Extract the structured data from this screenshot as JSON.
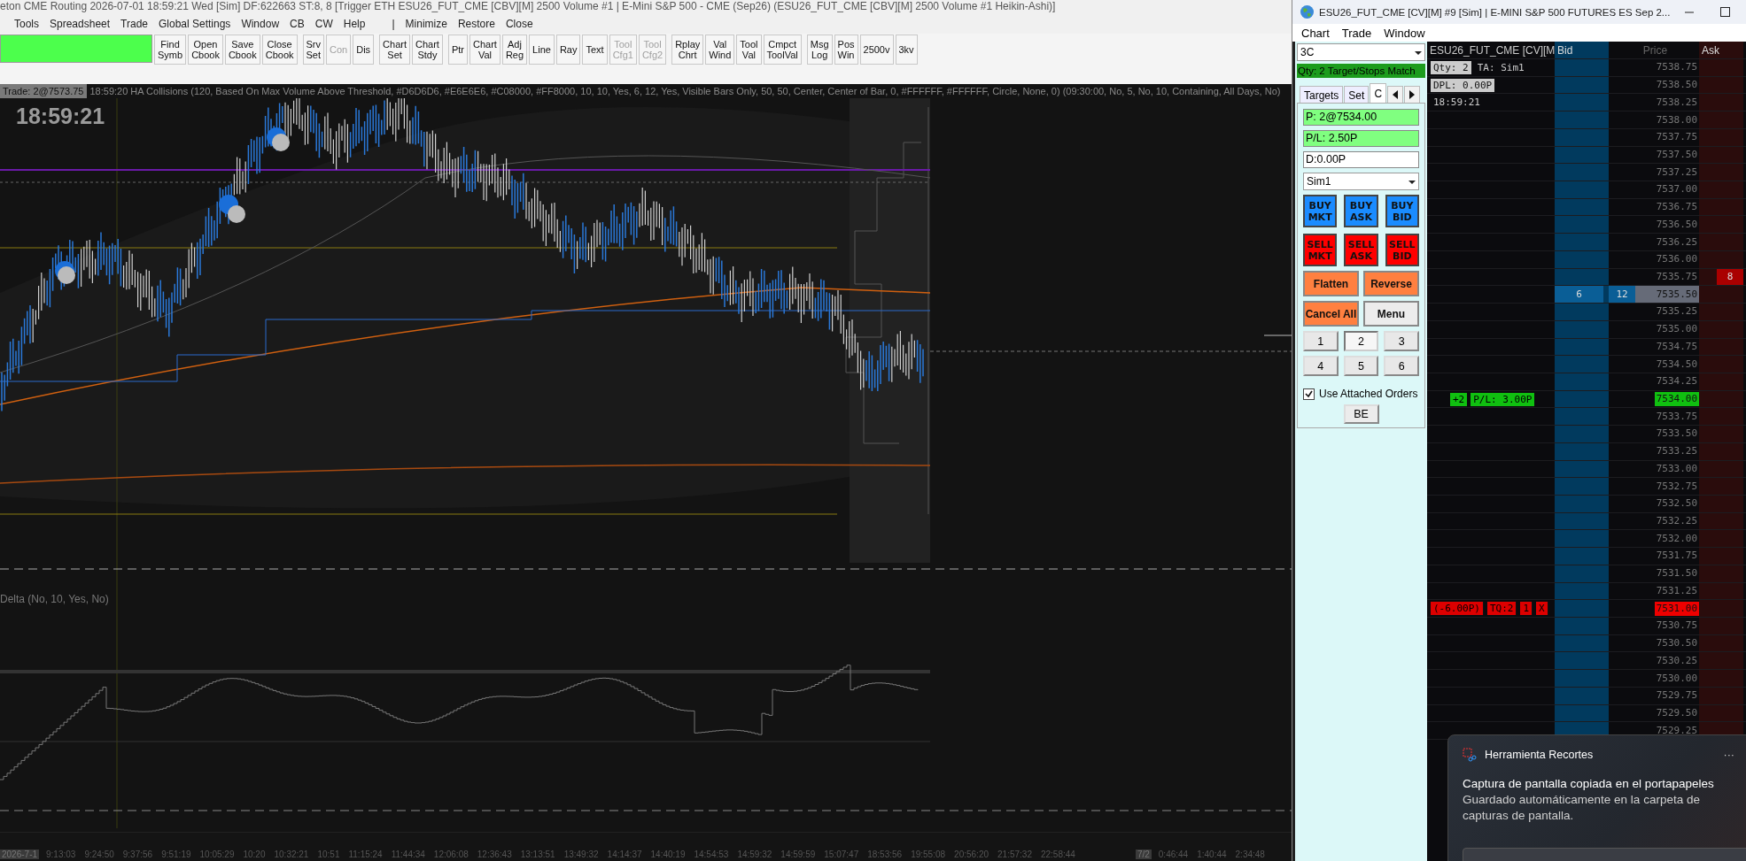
{
  "main_window": {
    "title": "eton CME Routing 2026-07-01  18:59:21 Wed [Sim] DF:622663  ST:8, 8 [Trigger ETH ESU26_FUT_CME [CBV][M]  2500 Volume #1 | E-Mini S&P 500 - CME (Sep26) (ESU26_FUT_CME [CBV][M]  2500 Volume #1 Heikin-Ashi)]",
    "menu": [
      "Tools",
      "Spreadsheet",
      "Trade",
      "Global Settings",
      "Window",
      "CB",
      "CW",
      "Help",
      "|",
      "Minimize",
      "Restore",
      "Close"
    ],
    "toolbar": [
      {
        "label": "Find\nSymb",
        "disabled": false
      },
      {
        "label": "Open\nCbook",
        "disabled": false
      },
      {
        "label": "Save\nCbook",
        "disabled": false
      },
      {
        "label": "Close\nCbook",
        "disabled": false
      },
      {
        "label": "Srv\nSet",
        "disabled": false
      },
      {
        "label": "Con",
        "disabled": true
      },
      {
        "label": "Dis",
        "disabled": false
      },
      {
        "label": "Chart\nSet",
        "disabled": false
      },
      {
        "label": "Chart\nStdy",
        "disabled": false
      },
      {
        "label": "Ptr",
        "disabled": false
      },
      {
        "label": "Chart\nVal",
        "disabled": false
      },
      {
        "label": "Adj\nReg",
        "disabled": false
      },
      {
        "label": "Line",
        "disabled": false
      },
      {
        "label": "Ray",
        "disabled": false
      },
      {
        "label": "Text",
        "disabled": false
      },
      {
        "label": "Tool\nCfg1",
        "disabled": true
      },
      {
        "label": "Tool\nCfg2",
        "disabled": true
      },
      {
        "label": "Rplay\nChrt",
        "disabled": false
      },
      {
        "label": "Val\nWind",
        "disabled": false
      },
      {
        "label": "Tool\nVal",
        "disabled": false
      },
      {
        "label": "Cmpct\nToolVal",
        "disabled": false
      },
      {
        "label": "Msg\nLog",
        "disabled": false
      },
      {
        "label": "Pos\nWin",
        "disabled": false
      },
      {
        "label": "2500v",
        "disabled": false
      },
      {
        "label": "3kv",
        "disabled": false
      }
    ],
    "chart": {
      "trade_label": "Trade: 2@7573.75",
      "study_line": "18:59:20 HA Collisions   (120, Based On Max Volume Above Threshold, #D6D6D6, #E6E6E6, #C08000, #FF8000, 10, 10, Yes, 6, 12, Yes, Visible Bars Only, 50, 50, Center, Center of Bar, 0, #FFFFFF, #FFFFFF, Circle, None, 0)   (09:30:00, No, 5, No, 10, Containing, All Days, No)",
      "clock": "18:59:21",
      "delta_label": "Delta   (No, 10, Yes, No)"
    },
    "time_axis": [
      {
        "label": "2026-7-1",
        "kind": "date"
      },
      {
        "label": "9:13:03",
        "kind": "time"
      },
      {
        "label": "9:24:50",
        "kind": "time"
      },
      {
        "label": "9:37:56",
        "kind": "time"
      },
      {
        "label": "9:51:19",
        "kind": "time"
      },
      {
        "label": "10:05:29",
        "kind": "time"
      },
      {
        "label": "10:20",
        "kind": "time"
      },
      {
        "label": "10:32:21",
        "kind": "time"
      },
      {
        "label": "10:51",
        "kind": "time"
      },
      {
        "label": "11:15:24",
        "kind": "time"
      },
      {
        "label": "11:44:34",
        "kind": "time"
      },
      {
        "label": "12:06:08",
        "kind": "time"
      },
      {
        "label": "12:36:43",
        "kind": "time"
      },
      {
        "label": "13:13:51",
        "kind": "time"
      },
      {
        "label": "13:49:32",
        "kind": "time"
      },
      {
        "label": "14:14:37",
        "kind": "time"
      },
      {
        "label": "14:40:19",
        "kind": "time"
      },
      {
        "label": "14:54:53",
        "kind": "time"
      },
      {
        "label": "14:59:32",
        "kind": "time"
      },
      {
        "label": "14:59:59",
        "kind": "time"
      },
      {
        "label": "15:07:47",
        "kind": "time"
      },
      {
        "label": "18:53:56",
        "kind": "time"
      },
      {
        "label": "19:55:08",
        "kind": "time"
      },
      {
        "label": "20:56:20",
        "kind": "time"
      },
      {
        "label": "21:57:32",
        "kind": "time"
      },
      {
        "label": "22:58:44",
        "kind": "time"
      },
      {
        "label": "7/2",
        "kind": "date"
      },
      {
        "label": "0:46:44",
        "kind": "time"
      },
      {
        "label": "1:40:44",
        "kind": "time"
      },
      {
        "label": "2:34:48",
        "kind": "time"
      }
    ]
  },
  "dom_window": {
    "title": "ESU26_FUT_CME [CV][M] #9 [Sim]  | E-MINI S&P 500 FUTURES ES Sep 2...",
    "menu": [
      "Chart",
      "Trade",
      "Window"
    ],
    "panel": {
      "config": "3C",
      "status": "Qty: 2 Target/Stops Match",
      "tabs": [
        {
          "label": "Targets",
          "selected": false
        },
        {
          "label": "Set",
          "selected": false
        },
        {
          "label": "C",
          "selected": true
        }
      ],
      "fields": [
        {
          "value": "P: 2@7534.00",
          "kind": "good"
        },
        {
          "value": "P/L: 2.50P",
          "kind": "good"
        },
        {
          "value": "D:0.00P",
          "kind": "plain"
        }
      ],
      "account": "Sim1",
      "order_buttons": [
        {
          "label": "BUY\nMKT",
          "kind": "buy"
        },
        {
          "label": "BUY\nASK",
          "kind": "buy"
        },
        {
          "label": "BUY\nBID",
          "kind": "buy"
        },
        {
          "label": "SELL\nMKT",
          "kind": "sell"
        },
        {
          "label": "SELL\nASK",
          "kind": "sell"
        },
        {
          "label": "SELL\nBID",
          "kind": "sell"
        }
      ],
      "action_buttons": [
        {
          "label": "Flatten",
          "kind": "action"
        },
        {
          "label": "Reverse",
          "kind": "action"
        },
        {
          "label": "Cancel All",
          "kind": "action"
        },
        {
          "label": "Menu",
          "kind": "plain"
        }
      ],
      "quantities": [
        {
          "label": "1",
          "selected": false
        },
        {
          "label": "2",
          "selected": true
        },
        {
          "label": "3",
          "selected": false
        },
        {
          "label": "4",
          "selected": false
        },
        {
          "label": "5",
          "selected": false
        },
        {
          "label": "6",
          "selected": false
        }
      ],
      "use_attached_orders": {
        "label": "Use Attached Orders",
        "checked": true
      },
      "be_button": "BE"
    },
    "ladder": {
      "columns": [
        "ESU26_FUT_CME [CV][M",
        "Bid",
        "Price",
        "Ask"
      ],
      "rows": [
        {
          "price": "7538.75",
          "kind": "normal",
          "info": [
            {
              "text": "Qty: 2",
              "kind": "tag"
            },
            {
              "text": "TA: Sim1",
              "kind": "text"
            }
          ]
        },
        {
          "price": "7538.50",
          "kind": "normal",
          "info": [
            {
              "text": "DPL: 0.00P",
              "kind": "tag"
            }
          ]
        },
        {
          "price": "7538.25",
          "kind": "normal",
          "info": [
            {
              "text": "18:59:21",
              "kind": "text"
            }
          ]
        },
        {
          "price": "7538.00",
          "kind": "normal"
        },
        {
          "price": "7537.75",
          "kind": "normal"
        },
        {
          "price": "7537.50",
          "kind": "normal"
        },
        {
          "price": "7537.25",
          "kind": "normal"
        },
        {
          "price": "7537.00",
          "kind": "normal"
        },
        {
          "price": "7536.75",
          "kind": "normal"
        },
        {
          "price": "7536.50",
          "kind": "normal"
        },
        {
          "price": "7536.25",
          "kind": "normal"
        },
        {
          "price": "7536.00",
          "kind": "normal"
        },
        {
          "price": "7535.75",
          "kind": "normal",
          "ask": "8"
        },
        {
          "price": "7535.50",
          "kind": "last",
          "bid": "6",
          "volume": "12"
        },
        {
          "price": "7535.25",
          "kind": "normal"
        },
        {
          "price": "7535.00",
          "kind": "normal"
        },
        {
          "price": "7534.75",
          "kind": "normal"
        },
        {
          "price": "7534.50",
          "kind": "normal"
        },
        {
          "price": "7534.25",
          "kind": "normal"
        },
        {
          "price": "7534.00",
          "kind": "position",
          "info": [
            {
              "text": "+2",
              "kind": "good"
            },
            {
              "text": "P/L: 3.00P",
              "kind": "good"
            }
          ]
        },
        {
          "price": "7533.75",
          "kind": "normal"
        },
        {
          "price": "7533.50",
          "kind": "normal"
        },
        {
          "price": "7533.25",
          "kind": "normal"
        },
        {
          "price": "7533.00",
          "kind": "normal"
        },
        {
          "price": "7532.75",
          "kind": "normal"
        },
        {
          "price": "7532.50",
          "kind": "normal"
        },
        {
          "price": "7532.25",
          "kind": "normal"
        },
        {
          "price": "7532.00",
          "kind": "normal"
        },
        {
          "price": "7531.75",
          "kind": "normal"
        },
        {
          "price": "7531.50",
          "kind": "normal"
        },
        {
          "price": "7531.25",
          "kind": "normal"
        },
        {
          "price": "7531.00",
          "kind": "stop",
          "info": [
            {
              "text": "(-6.00P)",
              "kind": "bad"
            },
            {
              "text": "TQ:2",
              "kind": "bad"
            },
            {
              "text": "1",
              "kind": "bad"
            },
            {
              "text": "X",
              "kind": "bad"
            }
          ]
        },
        {
          "price": "7530.75",
          "kind": "normal"
        },
        {
          "price": "7530.50",
          "kind": "normal"
        },
        {
          "price": "7530.25",
          "kind": "normal"
        },
        {
          "price": "7530.00",
          "kind": "normal"
        },
        {
          "price": "7529.75",
          "kind": "normal"
        },
        {
          "price": "7529.50",
          "kind": "normal"
        },
        {
          "price": "7529.25",
          "kind": "normal"
        }
      ]
    }
  },
  "notification": {
    "app": "Herramienta Recortes",
    "more": "···",
    "title": "Captura de pantalla copiada en el portapapeles",
    "body": "Guardado automáticamente en la carpeta de capturas de pantalla."
  }
}
